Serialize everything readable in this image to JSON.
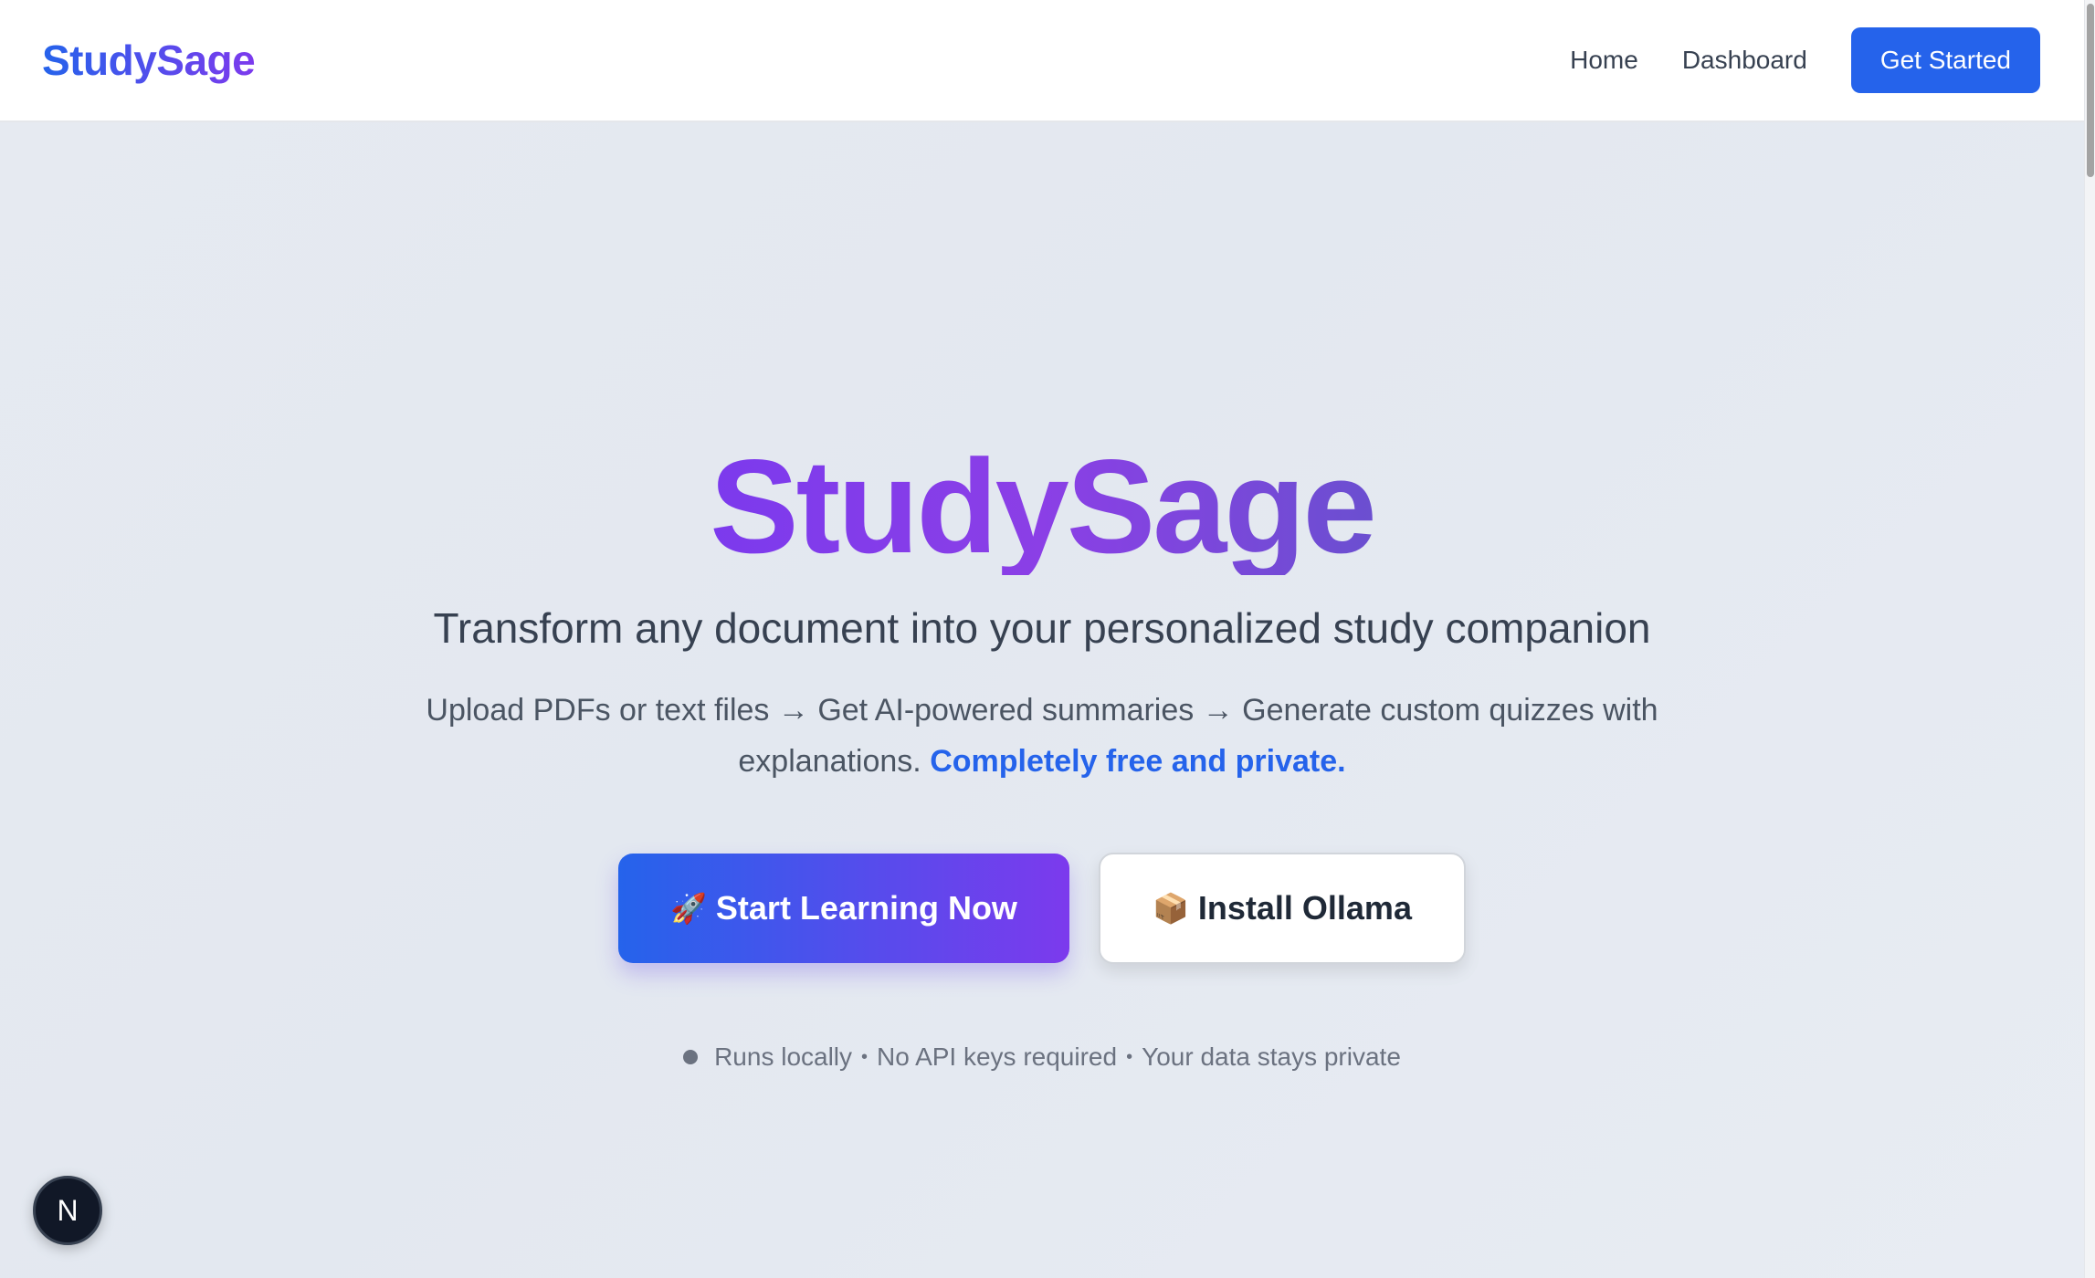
{
  "header": {
    "logo": "StudySage",
    "nav": {
      "home": "Home",
      "dashboard": "Dashboard",
      "cta": "Get Started"
    }
  },
  "hero": {
    "title": "StudySage",
    "subtitle": "Transform any document into your personalized study companion",
    "description": "Upload PDFs or text files → Get AI-powered summaries → Generate custom quizzes with explanations.",
    "description_accent": "Completely free and private.",
    "primary_button": {
      "icon": "🚀",
      "label": "Start Learning Now"
    },
    "secondary_button": {
      "icon": "📦",
      "label": "Install Ollama"
    },
    "notes": {
      "item1": "Runs locally",
      "item2": "No API keys required",
      "item3": "Your data stays private",
      "separator": "•"
    }
  },
  "badge": {
    "letter": "N"
  },
  "colors": {
    "primary_blue": "#2563eb",
    "accent_purple": "#7c3aed",
    "page_bg": "#e6eaf1"
  }
}
